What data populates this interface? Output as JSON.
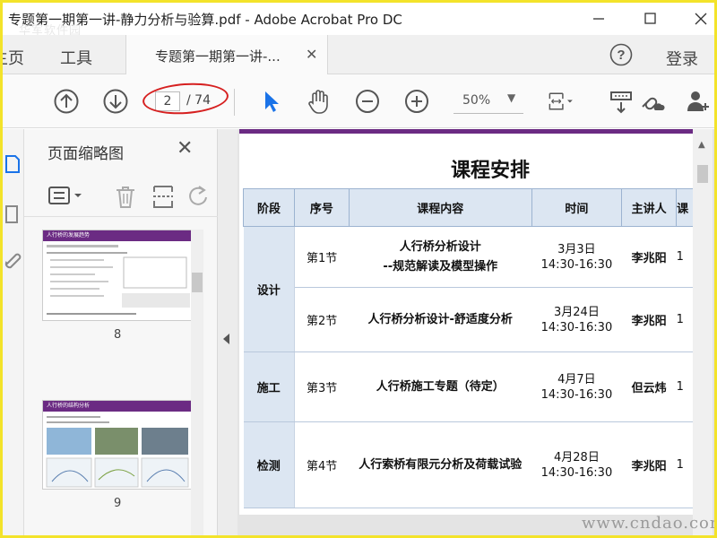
{
  "window": {
    "title": "专题第一期第一讲-静力分析与验算.pdf - Adobe Acrobat Pro DC",
    "watermark": "华军软件园"
  },
  "menu": {
    "home": "主页",
    "tools": "工具",
    "tab_label": "专题第一期第一讲-...",
    "login": "登录"
  },
  "toolbar": {
    "page_current": "2",
    "page_total": "/ 74",
    "zoom": "50%"
  },
  "thumb_panel": {
    "title": "页面缩略图",
    "thumbnails": [
      {
        "page": "8",
        "heading": "人行桥的发展趋势"
      },
      {
        "page": "9",
        "heading": "人行桥的结构分析"
      }
    ]
  },
  "document": {
    "heading": "课程安排",
    "columns": [
      "阶段",
      "序号",
      "课程内容",
      "时间",
      "主讲人",
      "课"
    ],
    "rows": [
      {
        "stage": "设计",
        "num": "第1节",
        "content1": "人行桥分析设计",
        "content2": "--规范解读及模型操作",
        "date": "3月3日",
        "time": "14:30-16:30",
        "speaker": "李兆阳",
        "extra": "1"
      },
      {
        "stage": "",
        "num": "第2节",
        "content1": "人行桥分析设计-舒适度分析",
        "content2": "",
        "date": "3月24日",
        "time": "14:30-16:30",
        "speaker": "李兆阳",
        "extra": "1"
      },
      {
        "stage": "施工",
        "num": "第3节",
        "content1": "人行桥施工专题（待定）",
        "content2": "",
        "date": "4月7日",
        "time": "14:30-16:30",
        "speaker": "但云炜",
        "extra": "1"
      },
      {
        "stage": "检测",
        "num": "第4节",
        "content1": "人行索桥有限元分析及荷载试验",
        "content2": "",
        "date": "4月28日",
        "time": "14:30-16:30",
        "speaker": "李兆阳",
        "extra": "1"
      }
    ]
  },
  "footer_watermark": "www.cndao.com",
  "colors": {
    "accent_purple": "#6b2b83",
    "header_blue": "#dce6f2",
    "annotation_red": "#d62020",
    "cursor_blue": "#1a73e8"
  }
}
